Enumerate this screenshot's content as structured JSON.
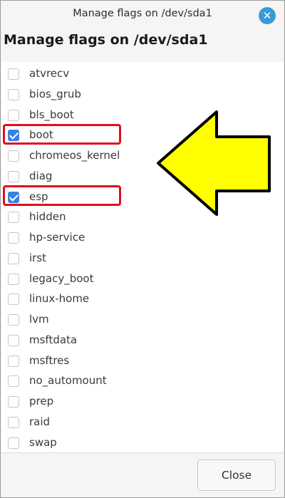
{
  "window": {
    "title": "Manage flags on /dev/sda1",
    "close_glyph": "✕"
  },
  "heading": "Manage flags on /dev/sda1",
  "flags": [
    {
      "label": "atvrecv",
      "checked": false
    },
    {
      "label": "bios_grub",
      "checked": false
    },
    {
      "label": "bls_boot",
      "checked": false
    },
    {
      "label": "boot",
      "checked": true
    },
    {
      "label": "chromeos_kernel",
      "checked": false
    },
    {
      "label": "diag",
      "checked": false
    },
    {
      "label": "esp",
      "checked": true
    },
    {
      "label": "hidden",
      "checked": false
    },
    {
      "label": "hp-service",
      "checked": false
    },
    {
      "label": "irst",
      "checked": false
    },
    {
      "label": "legacy_boot",
      "checked": false
    },
    {
      "label": "linux-home",
      "checked": false
    },
    {
      "label": "lvm",
      "checked": false
    },
    {
      "label": "msftdata",
      "checked": false
    },
    {
      "label": "msftres",
      "checked": false
    },
    {
      "label": "no_automount",
      "checked": false
    },
    {
      "label": "prep",
      "checked": false
    },
    {
      "label": "raid",
      "checked": false
    },
    {
      "label": "swap",
      "checked": false
    }
  ],
  "footer": {
    "close_label": "Close"
  },
  "colors": {
    "checkbox_checked": "#3584e4",
    "title_close_icon": "#3a9ad9",
    "highlight_box": "#e0101b",
    "annotation_arrow_fill": "#ffff00",
    "annotation_arrow_stroke": "#000000"
  },
  "icons": {
    "window_close": "close-icon",
    "checkmark": "check-icon",
    "annotation": "arrow-left-icon"
  }
}
